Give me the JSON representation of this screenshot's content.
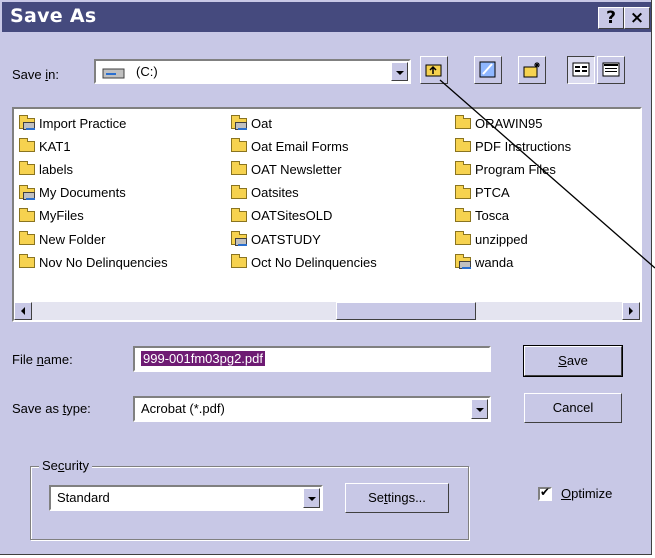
{
  "dialog": {
    "title": "Save As",
    "help_label": "?",
    "close_label": "×"
  },
  "save_in": {
    "label_pre": "Save ",
    "label_key": "i",
    "label_post": "n:",
    "value": "(C:)"
  },
  "toolbar": {
    "up_icon": "up-folder-icon",
    "desktop_icon": "desktop-icon",
    "new_folder_icon": "new-folder-icon",
    "list_view_icon": "list-view-icon",
    "details_view_icon": "details-view-icon"
  },
  "files": {
    "col1": [
      "Import Practice",
      "KAT1",
      "labels",
      "My Documents",
      "MyFiles",
      "New Folder",
      "Nov No Delinquencies"
    ],
    "col2": [
      "Oat",
      "Oat Email Forms",
      "OAT Newsletter",
      "Oatsites",
      "OATSitesOLD",
      "OATSTUDY",
      "Oct No Delinquencies"
    ],
    "col3": [
      "ORAWIN95",
      "PDF Instructions",
      "Program Files",
      "PTCA",
      "Tosca",
      "unzipped",
      "wanda"
    ]
  },
  "file_name": {
    "label_pre": "File ",
    "label_key": "n",
    "label_post": "ame:",
    "value": "999-001fm03pg2.pdf"
  },
  "save_type": {
    "label_pre": "Save as ",
    "label_key": "t",
    "label_post": "ype:",
    "value": "Acrobat (*.pdf)"
  },
  "buttons": {
    "save_key": "S",
    "save_rest": "ave",
    "cancel": "Cancel"
  },
  "security": {
    "legend_pre": "Se",
    "legend_key": "c",
    "legend_post": "urity",
    "value": "Standard",
    "settings_pre": "Se",
    "settings_key": "t",
    "settings_post": "tings..."
  },
  "optimize": {
    "label_key": "O",
    "label_rest": "ptimize",
    "checked": true
  }
}
